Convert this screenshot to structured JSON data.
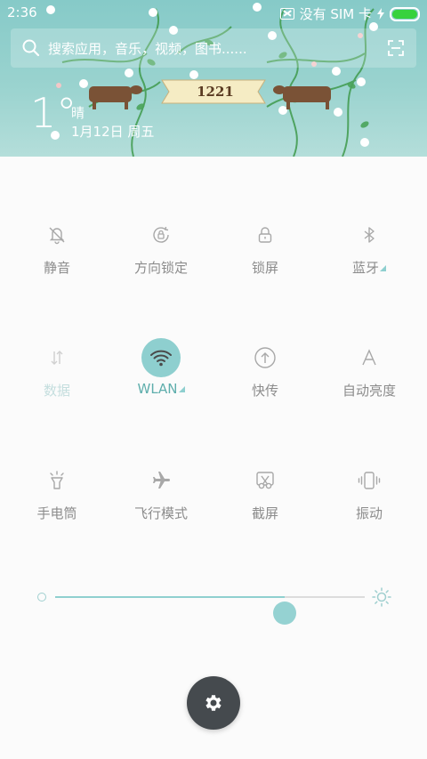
{
  "status_bar": {
    "time": "2:36",
    "sim_text": "没有 SIM 卡",
    "battery_level": 1.0,
    "battery_color": "#37d23d"
  },
  "header": {
    "search_placeholder": "搜索应用，音乐，视频，图书......",
    "banner_text": "1221",
    "weather": {
      "temperature": "1°",
      "condition": "晴",
      "date": "1月12日 周五"
    },
    "bg_color": "#8fcdca"
  },
  "toggles": [
    {
      "id": "mute",
      "label": "静音",
      "icon": "bell-off-icon",
      "state": "off"
    },
    {
      "id": "rotation-lock",
      "label": "方向锁定",
      "icon": "rotation-lock-icon",
      "state": "off"
    },
    {
      "id": "lock-screen",
      "label": "锁屏",
      "icon": "padlock-icon",
      "state": "off"
    },
    {
      "id": "bluetooth",
      "label": "蓝牙",
      "icon": "bluetooth-icon",
      "state": "off",
      "has_menu": true
    },
    {
      "id": "mobile-data",
      "label": "数据",
      "icon": "data-arrows-icon",
      "state": "disabled"
    },
    {
      "id": "wlan",
      "label": "WLAN",
      "icon": "wifi-icon",
      "state": "on",
      "has_menu": true
    },
    {
      "id": "quick-transfer",
      "label": "快传",
      "icon": "upload-circle-icon",
      "state": "off"
    },
    {
      "id": "auto-brightness",
      "label": "自动亮度",
      "icon": "letter-a-icon",
      "state": "off"
    },
    {
      "id": "flashlight",
      "label": "手电筒",
      "icon": "flashlight-icon",
      "state": "off"
    },
    {
      "id": "airplane-mode",
      "label": "飞行模式",
      "icon": "airplane-icon",
      "state": "off"
    },
    {
      "id": "screenshot",
      "label": "截屏",
      "icon": "scissors-icon",
      "state": "off"
    },
    {
      "id": "vibrate",
      "label": "振动",
      "icon": "vibrate-icon",
      "state": "off"
    }
  ],
  "brightness": {
    "level": 0.74,
    "min_icon": "dim-circle-icon",
    "max_icon": "sun-icon",
    "accent_color": "#8fd0cf"
  },
  "settings_button": {
    "icon": "gear-icon"
  }
}
